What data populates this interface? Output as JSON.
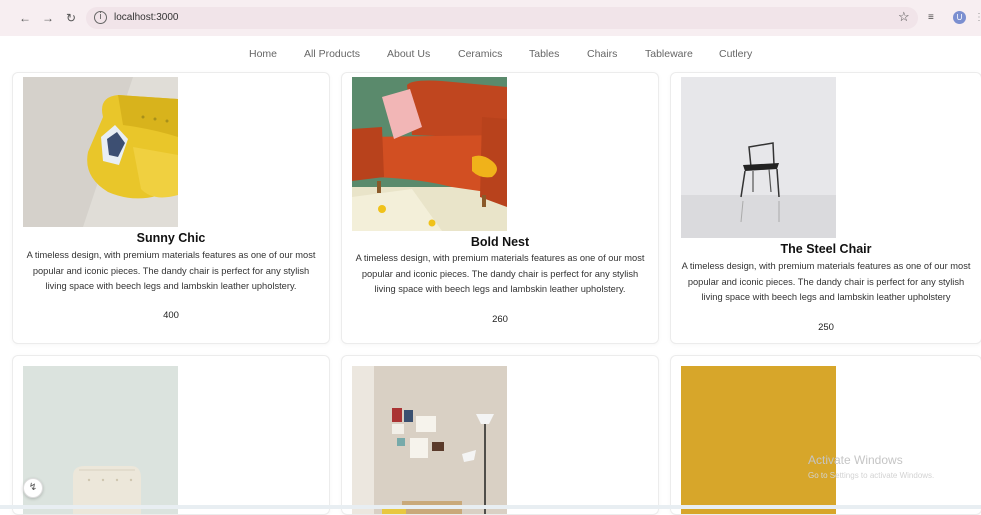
{
  "browser": {
    "url": "localhost:3000",
    "back_icon": "arrow-left-icon",
    "forward_icon": "arrow-right-icon",
    "reload_icon": "reload-icon",
    "profile_initial": "U"
  },
  "nav": {
    "items": [
      {
        "label": "Home"
      },
      {
        "label": "All Products"
      },
      {
        "label": "About Us"
      },
      {
        "label": "Ceramics"
      },
      {
        "label": "Tables"
      },
      {
        "label": "Chairs"
      },
      {
        "label": "Tableware"
      },
      {
        "label": "Cutlery"
      }
    ]
  },
  "products": [
    {
      "name": "Sunny Chic",
      "description": "A timeless design, with premium materials features as one of our most popular and iconic pieces. The dandy chair is perfect for any stylish living space with beech legs and lambskin leather upholstery.",
      "price": "400"
    },
    {
      "name": "Bold Nest",
      "description": "A timeless design, with premium materials features as one of our most popular and iconic pieces. The dandy chair is perfect for any stylish living space with beech legs and lambskin leather upholstery.",
      "price": "260"
    },
    {
      "name": "The Steel Chair",
      "description": "A timeless design, with premium materials features as one of our most popular and iconic pieces. The dandy chair is perfect for any stylish living space with beech legs and lambskin leather upholstery",
      "price": "250"
    }
  ],
  "watermark": {
    "line1": "Activate Windows",
    "line2": "Go to Settings to activate Windows."
  },
  "colors": {
    "browser_bar": "#f7eef1",
    "nav_text": "#666666"
  }
}
